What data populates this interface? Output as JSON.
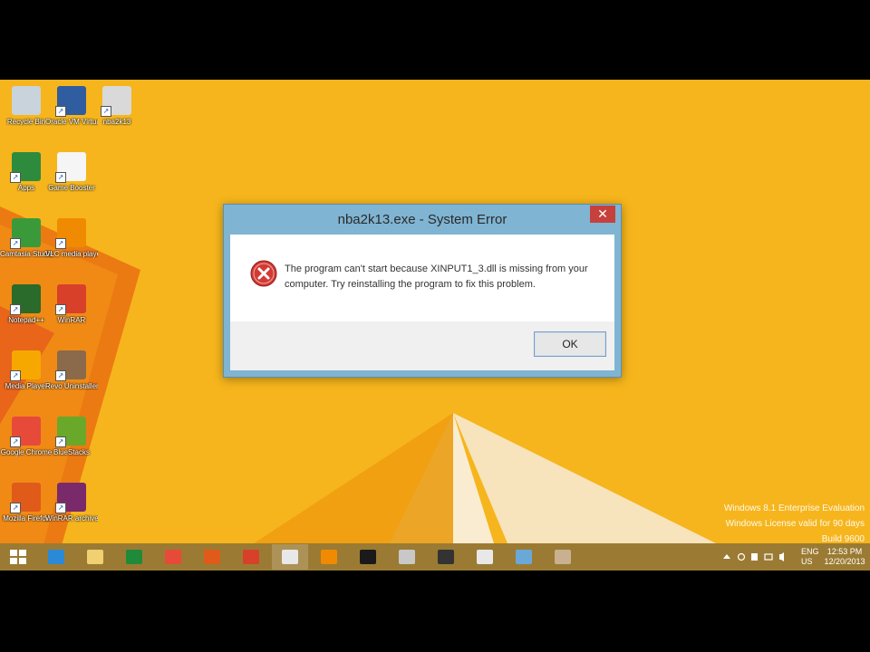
{
  "desktop": {
    "icons": [
      {
        "label": "Recycle Bin",
        "icon": "recycle-bin-icon",
        "color": "#c9d3dc"
      },
      {
        "label": "Oracle VM VirtualBox",
        "icon": "virtualbox-icon",
        "color": "#2f5da0"
      },
      {
        "label": "nba2k13",
        "icon": "game-icon",
        "color": "#d9d9d9"
      },
      {
        "label": "Apps",
        "icon": "apps-icon",
        "color": "#2e8b3d"
      },
      {
        "label": "Game Booster",
        "icon": "booster-icon",
        "color": "#f5f5f5"
      },
      {
        "label": "Camtasia Studio",
        "icon": "camtasia-icon",
        "color": "#3a9a3a"
      },
      {
        "label": "VLC media player",
        "icon": "vlc-icon",
        "color": "#f08a00"
      },
      {
        "label": "Notepad++",
        "icon": "editor-icon",
        "color": "#2a6a2a"
      },
      {
        "label": "WinRAR",
        "icon": "office-icon",
        "color": "#d8402a"
      },
      {
        "label": "Media Player",
        "icon": "media-player-icon",
        "color": "#f7a800"
      },
      {
        "label": "Revo Uninstaller",
        "icon": "uninstaller-icon",
        "color": "#8a6a4a"
      },
      {
        "label": "Google Chrome",
        "icon": "chrome-icon",
        "color": "#e84a3a"
      },
      {
        "label": "BlueStacks",
        "icon": "bluestacks-icon",
        "color": "#6aa82a"
      },
      {
        "label": "Mozilla Firefox",
        "icon": "firefox-icon",
        "color": "#e05a1a"
      },
      {
        "label": "WinRAR archive",
        "icon": "winrar-icon",
        "color": "#7a2a6a"
      }
    ]
  },
  "dialog": {
    "title": "nba2k13.exe - System Error",
    "message": "The program can't start because XINPUT1_3.dll is missing from your computer. Try reinstalling the program to fix this problem.",
    "ok_label": "OK",
    "close_label": "✕"
  },
  "watermark": {
    "line1": "Windows 8.1 Enterprise Evaluation",
    "line2": "Windows License valid for 90 days",
    "line3": "Build 9600"
  },
  "taskbar": {
    "buttons": [
      {
        "name": "start-button",
        "icon": "windows-logo-icon",
        "color": "#ffffff"
      },
      {
        "name": "internet-explorer-button",
        "icon": "internet-explorer-icon",
        "color": "#2a8ad8"
      },
      {
        "name": "file-explorer-button",
        "icon": "folder-icon",
        "color": "#f0d070"
      },
      {
        "name": "store-button",
        "icon": "store-icon",
        "color": "#1f8a3a"
      },
      {
        "name": "chrome-button",
        "icon": "chrome-icon",
        "color": "#e84a3a"
      },
      {
        "name": "firefox-button",
        "icon": "firefox-icon",
        "color": "#e05a1a"
      },
      {
        "name": "office-button",
        "icon": "office-icon",
        "color": "#d8402a"
      },
      {
        "name": "nba-dialog-button",
        "icon": "window-icon",
        "color": "#e8e8e8"
      },
      {
        "name": "vlc-button",
        "icon": "vlc-icon",
        "color": "#f08a00"
      },
      {
        "name": "headset-button",
        "icon": "headset-icon",
        "color": "#1a1a1a"
      },
      {
        "name": "paint-button",
        "icon": "paint-icon",
        "color": "#c8c8c8"
      },
      {
        "name": "virtualbox-button",
        "icon": "virtualbox-icon",
        "color": "#333333"
      },
      {
        "name": "calculator-button",
        "icon": "calculator-icon",
        "color": "#e8e8e8"
      },
      {
        "name": "photo-button",
        "icon": "photo-icon",
        "color": "#6aa8d8"
      },
      {
        "name": "app-button",
        "icon": "app-icon",
        "color": "#c8b090"
      }
    ],
    "lang_top": "ENG",
    "lang_bottom": "US",
    "time": "12:53 PM",
    "date": "12/20/2013"
  }
}
